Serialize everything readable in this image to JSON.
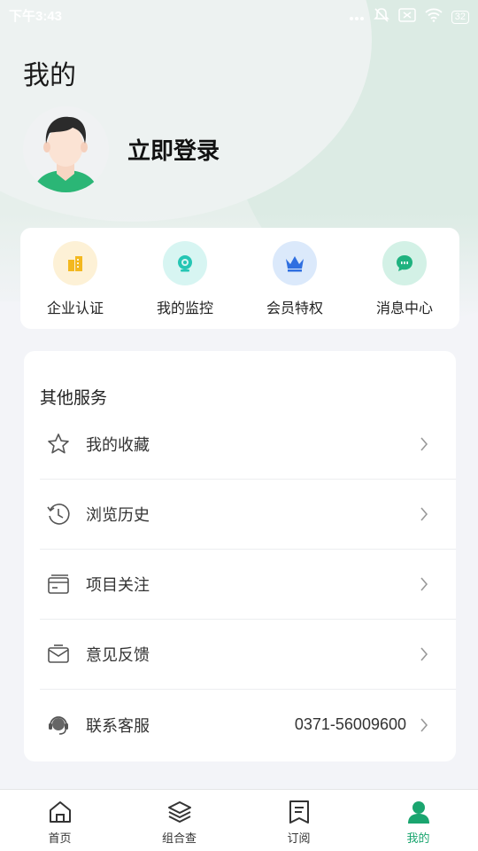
{
  "status_bar": {
    "time": "下午3:43",
    "battery": "32"
  },
  "page": {
    "title": "我的"
  },
  "profile": {
    "login_label": "立即登录"
  },
  "quick_actions": [
    {
      "label": "企业认证",
      "icon": "building-icon",
      "bg": "#fdf1d6",
      "color": "#f3b81f"
    },
    {
      "label": "我的监控",
      "icon": "camera-icon",
      "bg": "#d7f5f2",
      "color": "#25c6b4"
    },
    {
      "label": "会员特权",
      "icon": "crown-icon",
      "bg": "#dbe9fb",
      "color": "#2f6fe0"
    },
    {
      "label": "消息中心",
      "icon": "chat-icon",
      "bg": "#d3f1e6",
      "color": "#1fb27f"
    }
  ],
  "services": {
    "title": "其他服务",
    "items": [
      {
        "label": "我的收藏",
        "icon": "star-icon",
        "value": ""
      },
      {
        "label": "浏览历史",
        "icon": "history-icon",
        "value": ""
      },
      {
        "label": "项目关注",
        "icon": "card-icon",
        "value": ""
      },
      {
        "label": "意见反馈",
        "icon": "envelope-icon",
        "value": ""
      },
      {
        "label": "联系客服",
        "icon": "headset-icon",
        "value": "0371-56009600"
      }
    ]
  },
  "tabbar": {
    "items": [
      {
        "label": "首页",
        "icon": "home-icon",
        "active": false
      },
      {
        "label": "组合查",
        "icon": "layers-icon",
        "active": false
      },
      {
        "label": "订阅",
        "icon": "bookmark-list-icon",
        "active": false
      },
      {
        "label": "我的",
        "icon": "user-icon",
        "active": true
      }
    ],
    "active_color": "#1aa56f"
  }
}
